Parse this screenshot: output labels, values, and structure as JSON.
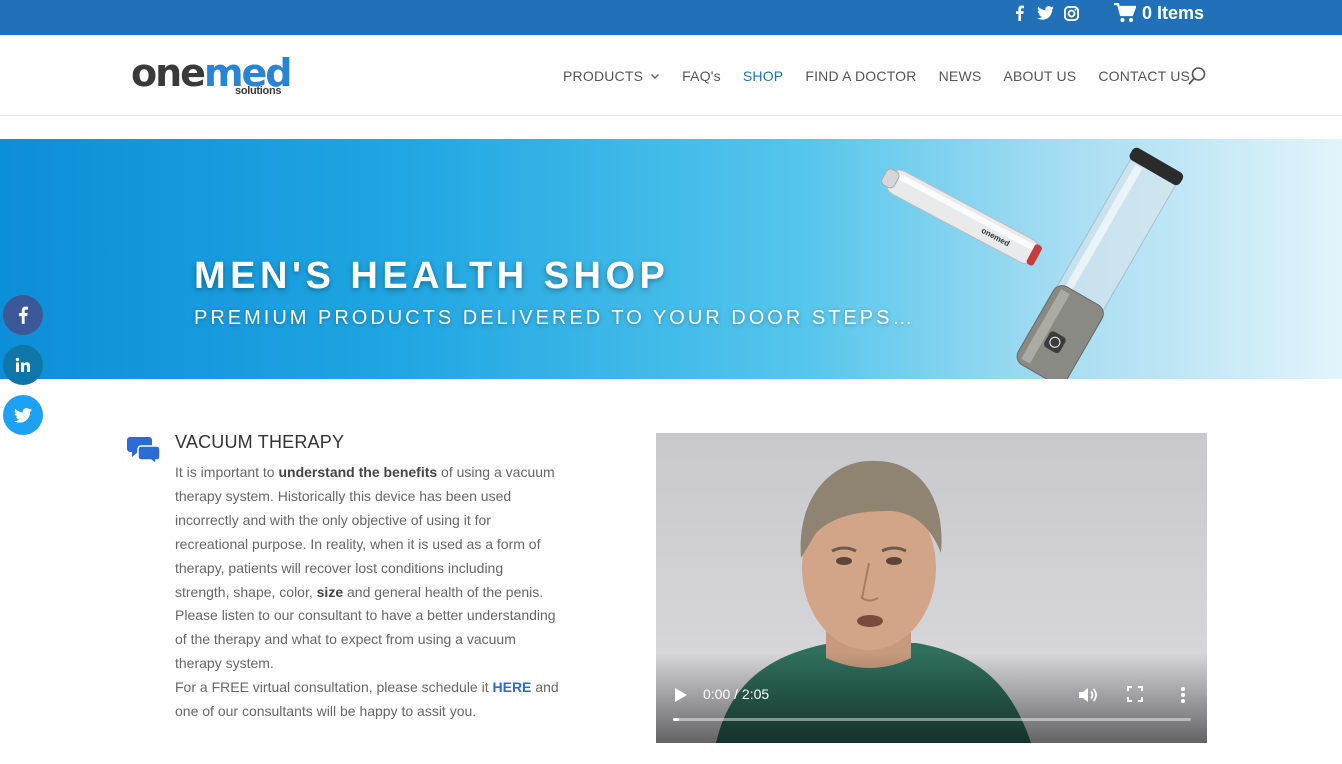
{
  "topbar": {
    "social_icons": [
      "facebook-icon",
      "twitter-icon",
      "instagram-icon"
    ],
    "cart_label": "0 Items",
    "background": "#2270b8"
  },
  "header": {
    "logo": {
      "word_one": "one",
      "word_med": "med",
      "sub": "solutions"
    },
    "nav": [
      {
        "label": "PRODUCTS",
        "has_dropdown": true
      },
      {
        "label": "FAQ's",
        "has_dropdown": false
      },
      {
        "label": "SHOP",
        "has_dropdown": false,
        "active": true
      },
      {
        "label": "FIND A DOCTOR",
        "has_dropdown": false
      },
      {
        "label": "NEWS",
        "has_dropdown": false
      },
      {
        "label": "ABOUT US",
        "has_dropdown": false
      },
      {
        "label": "CONTACT US",
        "has_dropdown": false
      }
    ],
    "accent": "#2270b8"
  },
  "hero": {
    "title": "MEN'S HEALTH SHOP",
    "subtitle": "PREMIUM PRODUCTS DELIVERED TO YOUR DOOR STEPS…",
    "device_brand": "onemed"
  },
  "side_social": [
    "facebook-icon",
    "linkedin-icon",
    "twitter-icon"
  ],
  "content": {
    "title": "VACUUM THERAPY",
    "p1_a": "It is important to ",
    "p1_b": "understand the benefits",
    "p1_c": " of using a vacuum therapy system. Historically this device has been used incorrectly and with the only objective of using it for recreational purpose. In reality, when it is used as a form of therapy, patients will recover lost conditions including strength, shape, color, ",
    "p1_d": "size",
    "p1_e": " and general health of the penis.",
    "p2": "Please listen to our consultant to have a better understanding of the therapy and what to expect from using a vacuum therapy system.",
    "p3_a": "For a FREE virtual consultation, please schedule it ",
    "p3_link": "HERE",
    "p3_b": " and one of our consultants will be happy to assit you."
  },
  "video": {
    "time": "0:00 / 2:05",
    "progress": 0.01
  }
}
